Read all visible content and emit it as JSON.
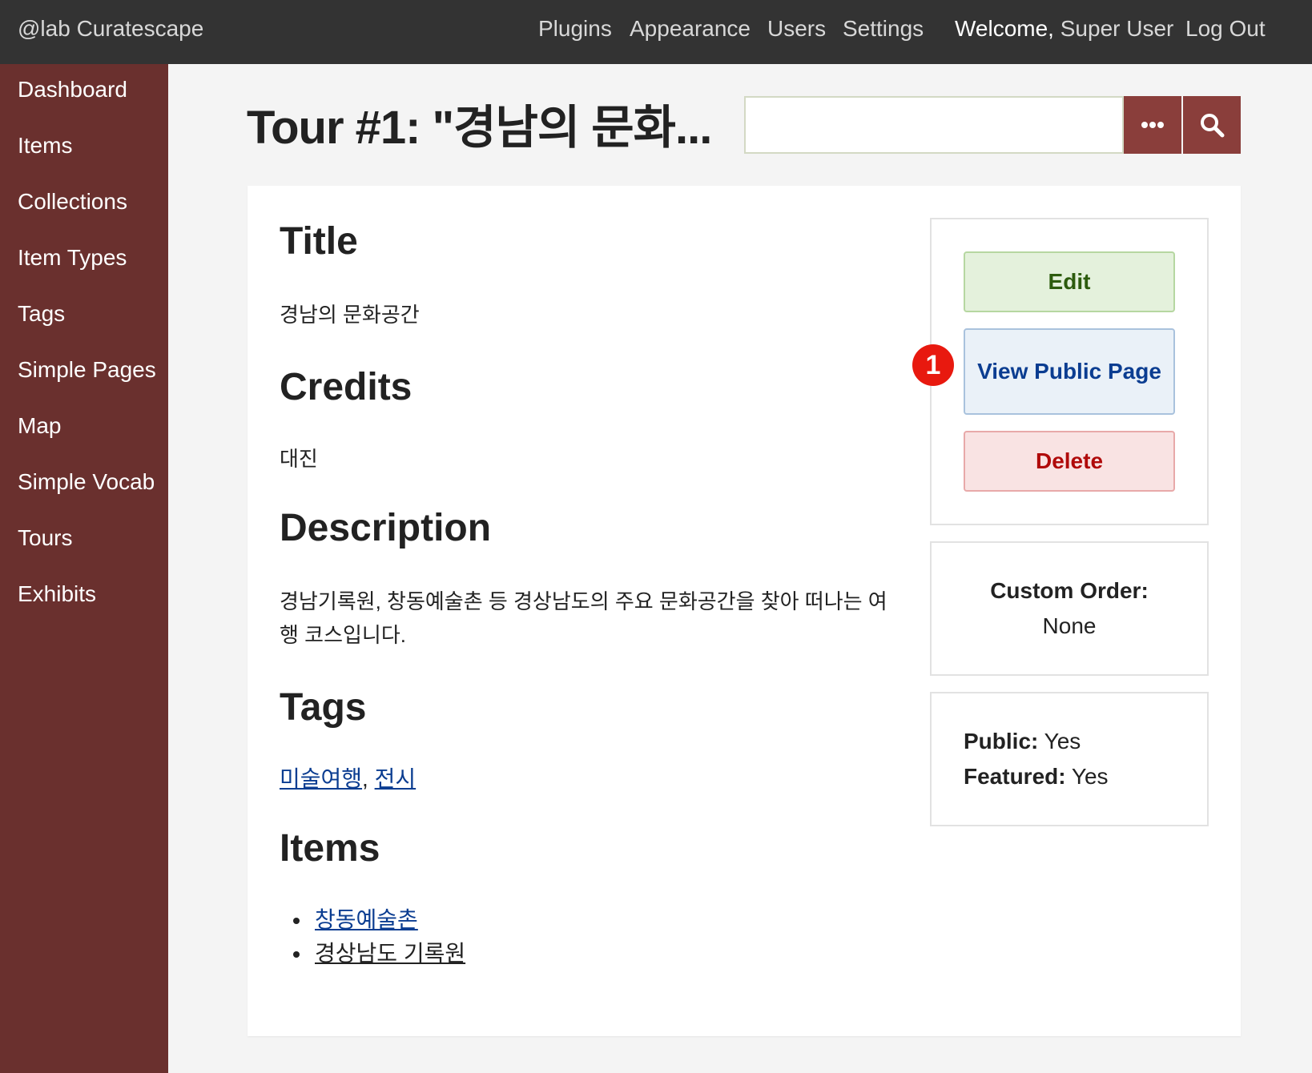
{
  "topbar": {
    "site_title": "@lab Curatescape",
    "nav": [
      "Plugins",
      "Appearance",
      "Users",
      "Settings"
    ],
    "welcome_label": "Welcome,",
    "user_name": "Super User",
    "logout": "Log Out",
    "background": "#333333"
  },
  "sidebar": {
    "background": "#6a302e",
    "items": [
      "Dashboard",
      "Items",
      "Collections",
      "Item Types",
      "Tags",
      "Simple Pages",
      "Map",
      "Simple Vocab",
      "Tours",
      "Exhibits"
    ]
  },
  "header": {
    "title": "Tour #1: \"경남의 문화...",
    "search_value": ""
  },
  "icons": {
    "advanced_search": "ellipsis-icon",
    "submit_search": "magnifier-icon"
  },
  "content": {
    "sections": {
      "title_heading": "Title",
      "title_value": "경남의 문화공간",
      "credits_heading": "Credits",
      "credits_value": "대진",
      "description_heading": "Description",
      "description_value": "경남기록원, 창동예술촌 등 경상남도의 주요 문화공간을 찾아 떠나는 여행 코스입니다.",
      "tags_heading": "Tags",
      "tags": [
        "미술여행",
        "전시"
      ],
      "tags_separator": ",",
      "items_heading": "Items",
      "items": [
        "창동예술촌",
        "경상남도 기록원"
      ]
    }
  },
  "actions": {
    "edit": "Edit",
    "view_public": "View Public Page",
    "delete": "Delete",
    "badge": "1",
    "badge_color": "#e8190f"
  },
  "meta": {
    "custom_order_label": "Custom Order:",
    "custom_order_value": "None",
    "public_label": "Public:",
    "public_value": "Yes",
    "featured_label": "Featured:",
    "featured_value": "Yes"
  }
}
